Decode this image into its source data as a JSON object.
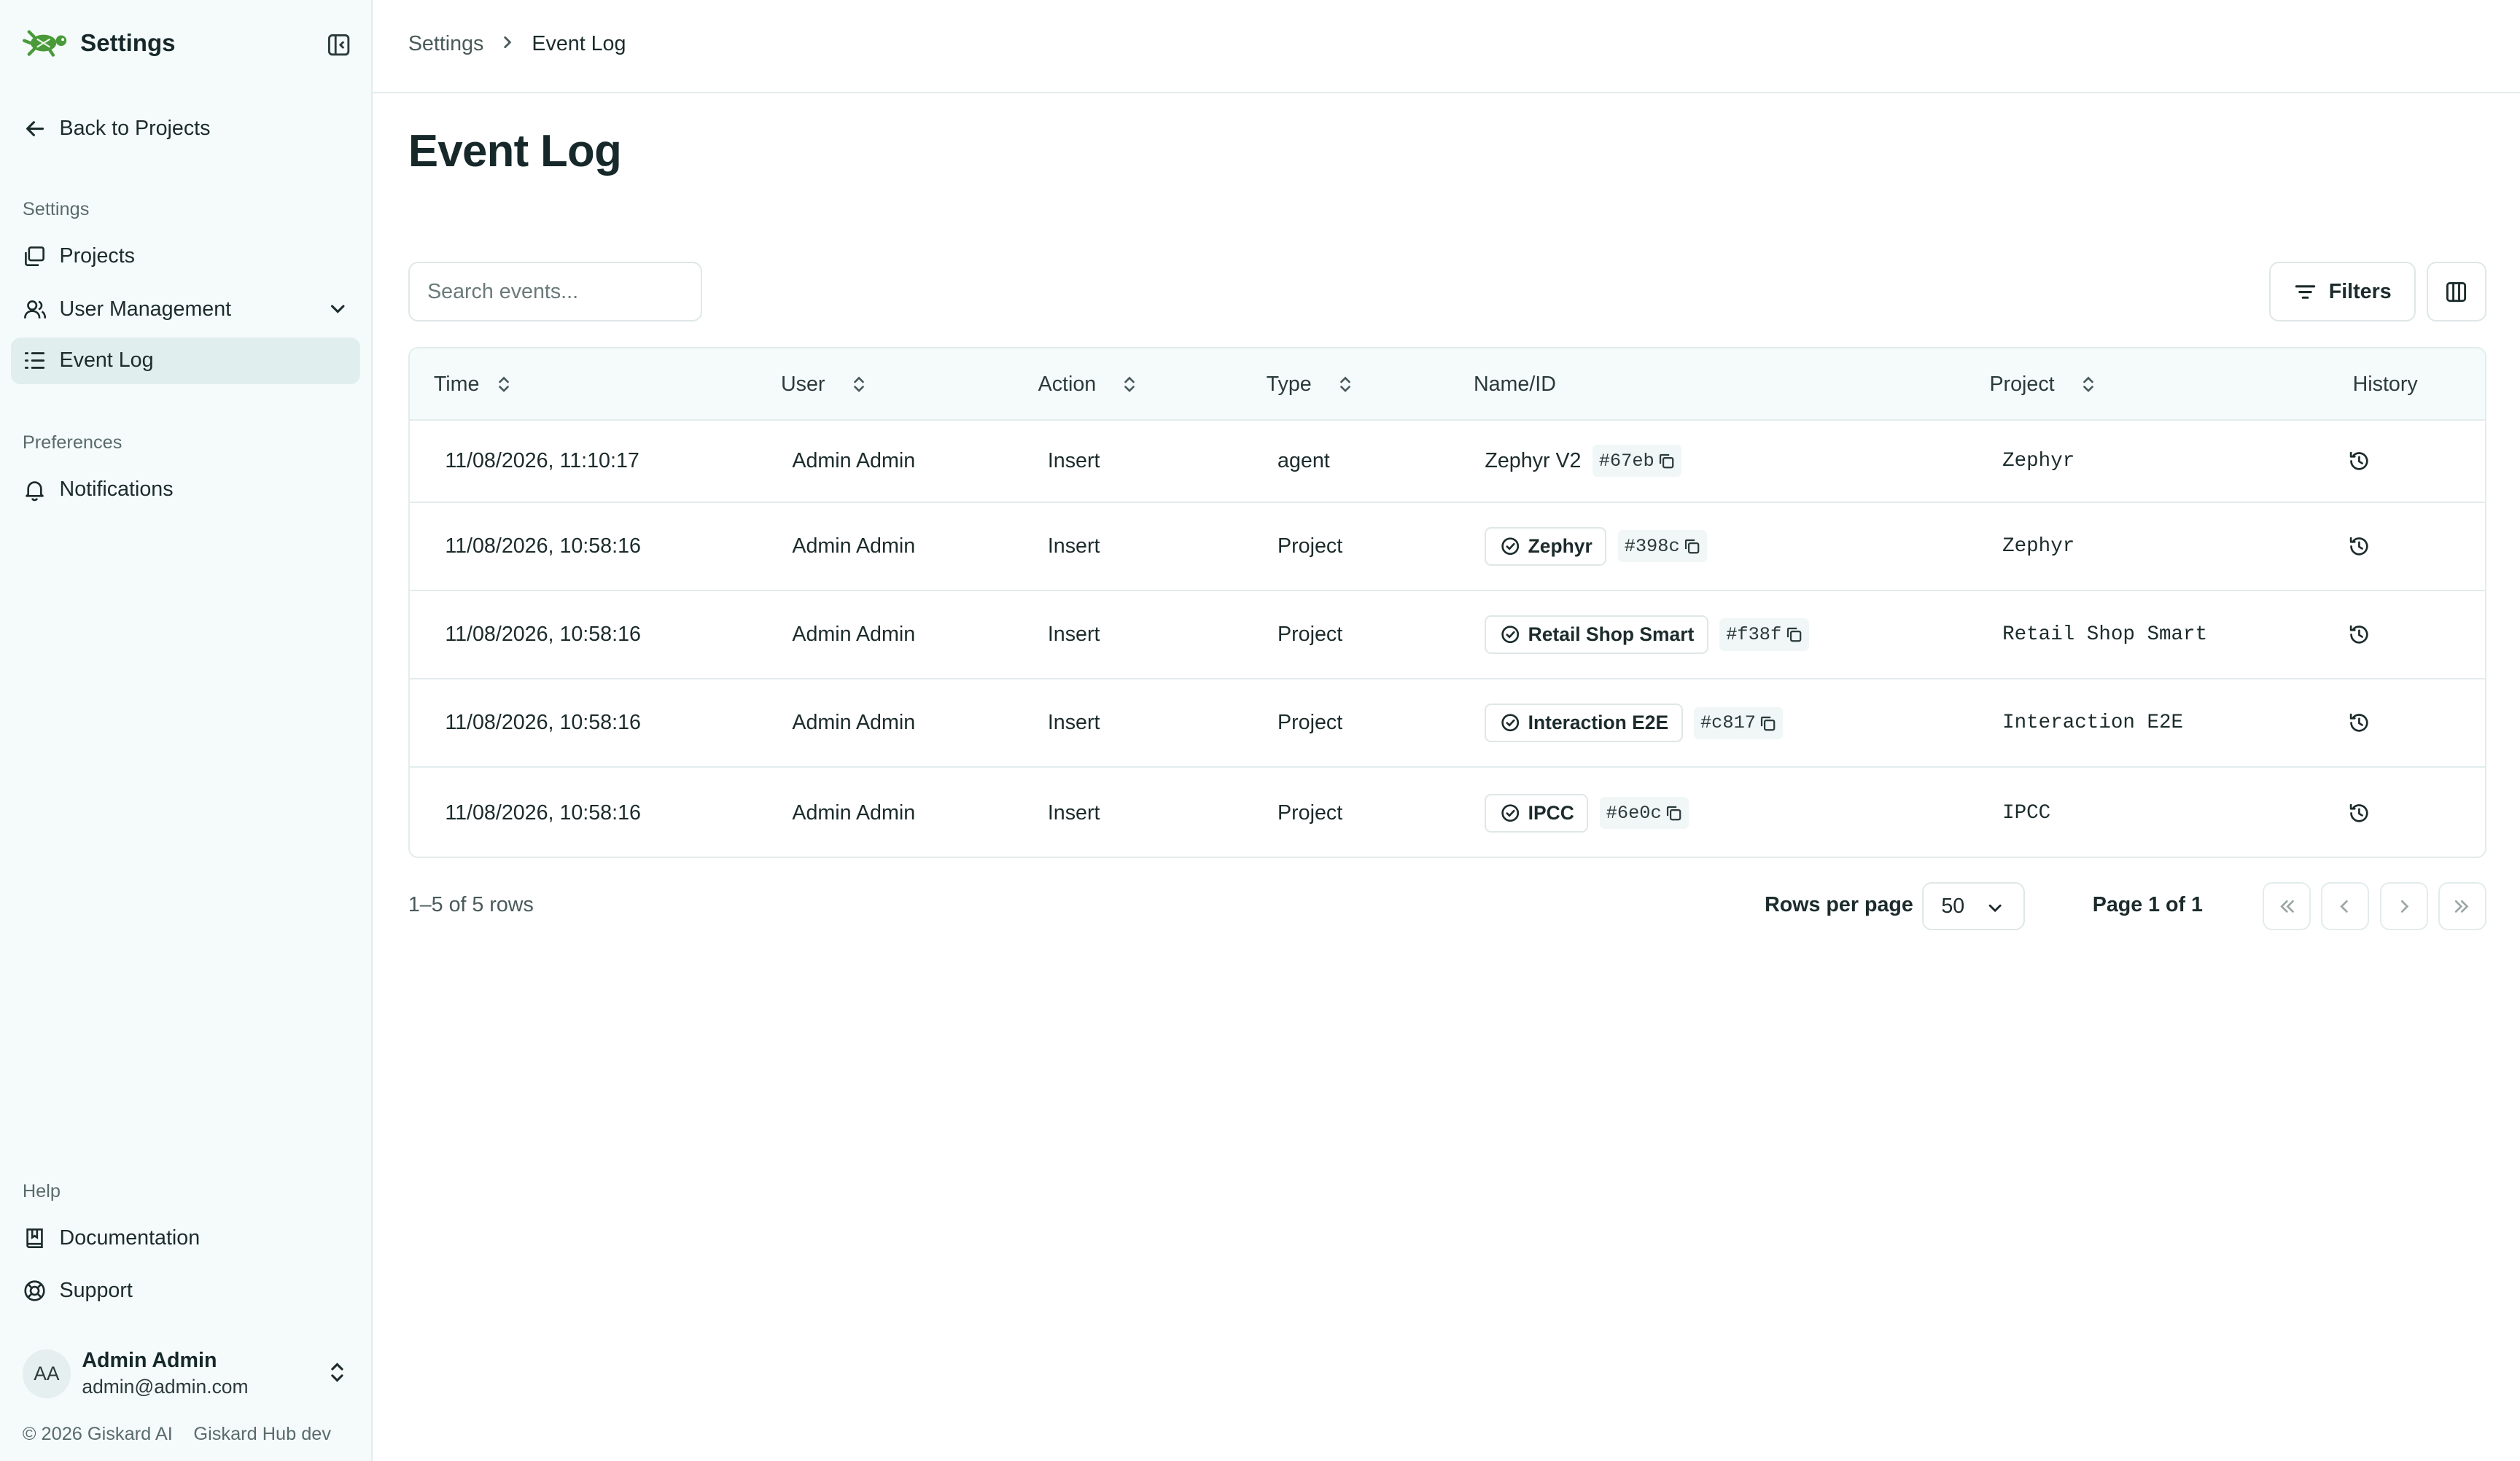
{
  "app": {
    "title": "Settings"
  },
  "sidebar": {
    "back_label": "Back to Projects",
    "settings_section": "Settings",
    "items": [
      {
        "label": "Projects",
        "icon": "projects-icon"
      },
      {
        "label": "User Management",
        "icon": "users-icon"
      },
      {
        "label": "Event Log",
        "icon": "list-icon",
        "active": true
      }
    ],
    "preferences_section": "Preferences",
    "preferences_items": [
      {
        "label": "Notifications",
        "icon": "bell-icon"
      }
    ],
    "help_section": "Help",
    "help_items": [
      {
        "label": "Documentation",
        "icon": "book-icon"
      },
      {
        "label": "Support",
        "icon": "lifebuoy-icon"
      }
    ],
    "user": {
      "initials": "AA",
      "name": "Admin Admin",
      "email": "admin@admin.com"
    },
    "footer": {
      "copyright": "© 2026 Giskard AI",
      "version": "Giskard Hub dev"
    }
  },
  "breadcrumb": {
    "parent": "Settings",
    "current": "Event Log"
  },
  "page": {
    "title": "Event Log"
  },
  "search": {
    "placeholder": "Search events..."
  },
  "toolbar": {
    "filters_label": "Filters"
  },
  "table": {
    "headers": {
      "time": "Time",
      "user": "User",
      "action": "Action",
      "type": "Type",
      "name_id": "Name/ID",
      "project": "Project",
      "history": "History"
    },
    "rows": [
      {
        "time": "11/08/2026, 11:10:17",
        "user": "Admin Admin",
        "action": "Insert",
        "type": "agent",
        "name": "Zephyr V2",
        "badge": false,
        "id": "#67eb",
        "project": "Zephyr"
      },
      {
        "time": "11/08/2026, 10:58:16",
        "user": "Admin Admin",
        "action": "Insert",
        "type": "Project",
        "name": "Zephyr",
        "badge": true,
        "id": "#398c",
        "project": "Zephyr"
      },
      {
        "time": "11/08/2026, 10:58:16",
        "user": "Admin Admin",
        "action": "Insert",
        "type": "Project",
        "name": "Retail Shop Smart",
        "badge": true,
        "id": "#f38f",
        "project": "Retail Shop Smart"
      },
      {
        "time": "11/08/2026, 10:58:16",
        "user": "Admin Admin",
        "action": "Insert",
        "type": "Project",
        "name": "Interaction E2E",
        "badge": true,
        "id": "#c817",
        "project": "Interaction E2E"
      },
      {
        "time": "11/08/2026, 10:58:16",
        "user": "Admin Admin",
        "action": "Insert",
        "type": "Project",
        "name": "IPCC",
        "badge": true,
        "id": "#6e0c",
        "project": "IPCC"
      }
    ]
  },
  "pagination": {
    "rows_count": "1–5 of 5 rows",
    "rows_per_page_label": "Rows per page",
    "rows_per_page": "50",
    "page_label": "Page 1 of 1"
  },
  "colors": {
    "accent_green": "#4a9a3a",
    "sidebar_bg": "#f5fbfb",
    "active_bg": "#e1eeee",
    "border": "#e3ecec"
  }
}
